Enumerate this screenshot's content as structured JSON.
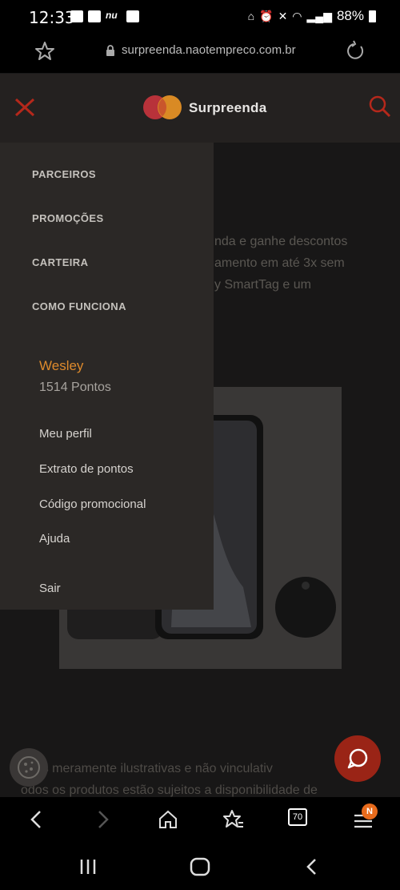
{
  "status_bar": {
    "time": "12:33",
    "battery": "88%"
  },
  "address_bar": {
    "url": "surpreenda.naotempreco.com.br"
  },
  "header": {
    "brand": "Surpreenda",
    "accent_color": "#de8a2c",
    "close_color": "#b5281b"
  },
  "menu": {
    "nav_items": [
      "PARCEIROS",
      "PROMOÇÕES",
      "CARTEIRA",
      "COMO FUNCIONA"
    ],
    "user": {
      "name": "Wesley",
      "points": "1514 Pontos"
    },
    "account_items": [
      "Meu perfil",
      "Extrato de pontos",
      "Código promocional",
      "Ajuda"
    ],
    "logout": "Sair"
  },
  "page": {
    "description_lines": [
      "nda e ganhe descontos",
      "amento em até 3x sem",
      "y SmartTag e um"
    ],
    "disclaimer_lines": [
      "gens meramente ilustrativas e não vinculativ",
      "odos os produtos estão sujeitos a disponibilidade de"
    ]
  },
  "browser_toolbar": {
    "tab_count": "70",
    "menu_badge": "N"
  }
}
